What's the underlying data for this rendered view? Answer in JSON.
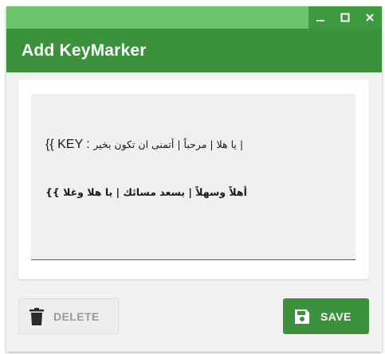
{
  "window": {
    "title": "Add KeyMarker",
    "controls": {
      "minimize_icon": "minimize-icon",
      "maximize_icon": "maximize-icon",
      "close_icon": "close-icon"
    }
  },
  "editor": {
    "line1_prefix": "{{ KEY : ",
    "line1_arabic": "يا هلا | مرحباً | أتمنى ان تكون بخير |",
    "line2": "{{ أهلاً وسهلاً | يسعد مسائك | يا هلا وغلا"
  },
  "buttons": {
    "delete_label": "DELETE",
    "delete_icon": "trash-icon",
    "save_label": "SAVE",
    "save_icon": "floppy-disk-icon"
  },
  "colors": {
    "header": "#3b913c",
    "titlebar": "#6cc36a",
    "titlebar_controls": "#3d9a3f",
    "save_button": "#3b913c",
    "delete_button": "#eeeeee"
  }
}
